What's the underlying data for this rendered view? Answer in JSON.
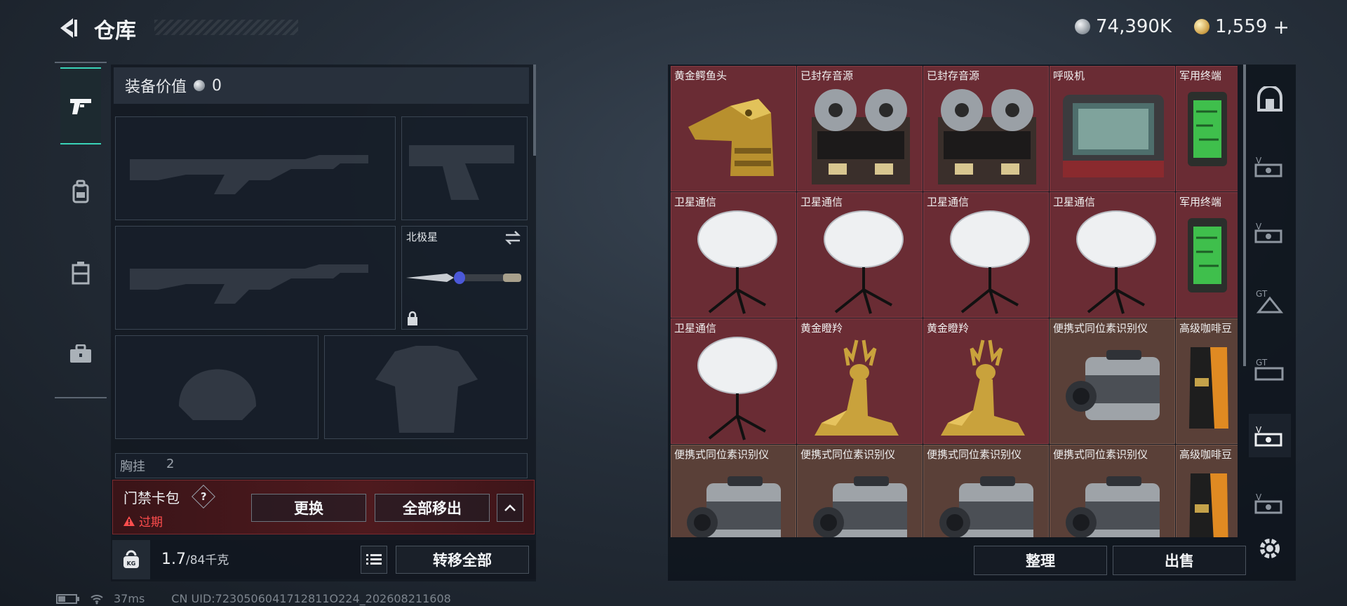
{
  "header": {
    "title": "仓库",
    "silver_amount": "74,390K",
    "gold_amount": "1,559",
    "gold_add_label": "+"
  },
  "equipment": {
    "value_label": "装备价值",
    "value_amount": "0",
    "melee_slot_label": "北极星",
    "chest_rig_label": "胸挂",
    "chest_rig_count": "2"
  },
  "access_card": {
    "title": "门禁卡包",
    "help": "?",
    "status": "过期",
    "replace_label": "更换",
    "move_all_label": "全部移出"
  },
  "weight": {
    "current": "1.7",
    "capacity": "/84千克",
    "transfer_all_label": "转移全部"
  },
  "inventory": {
    "sort_label": "整理",
    "sell_label": "出售",
    "rows": [
      [
        "黄金鳄鱼头",
        "已封存音源",
        "已封存音源",
        "呼吸机",
        "军用终端"
      ],
      [
        "卫星通信",
        "卫星通信",
        "卫星通信",
        "卫星通信",
        "军用终端"
      ],
      [
        "卫星通信",
        "黄金瞪羚",
        "黄金瞪羚",
        "便携式同位素识别仪",
        "高级咖啡豆"
      ],
      [
        "便携式同位素识别仪",
        "便携式同位素识别仪",
        "便携式同位素识别仪",
        "便携式同位素识别仪",
        "高级咖啡豆"
      ]
    ]
  },
  "status_bar": {
    "ping": "37ms",
    "uid": "CN UID:7230506041712811O224_202608211608"
  },
  "colors": {
    "accent_teal": "#39d3b8",
    "expired_red": "#ff4d4d",
    "cell_red": "#6a2c34",
    "cell_beige": "#5a4038"
  }
}
